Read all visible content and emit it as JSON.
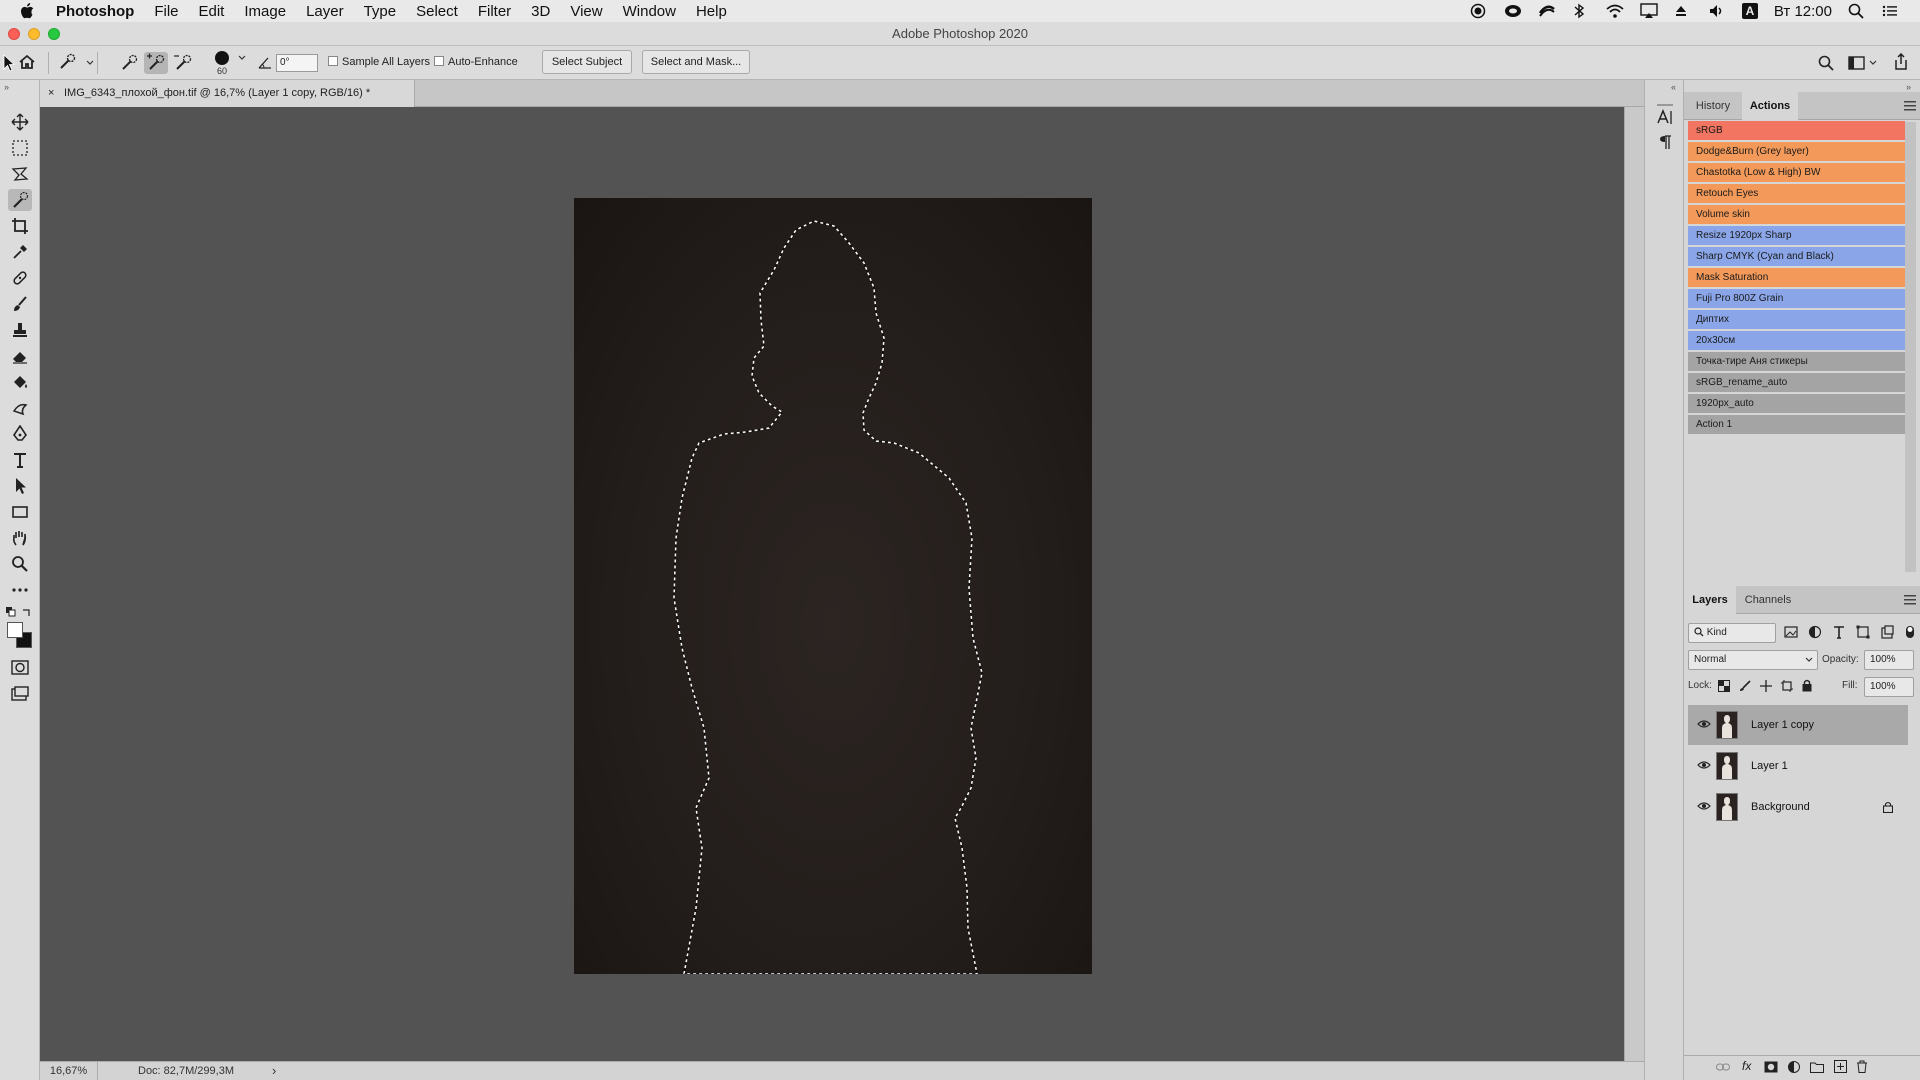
{
  "menubar": {
    "app_name": "Photoshop",
    "items": [
      "File",
      "Edit",
      "Image",
      "Layer",
      "Type",
      "Select",
      "Filter",
      "3D",
      "View",
      "Window",
      "Help"
    ],
    "clock": "Вт 12:00",
    "tray_icons": [
      "record-icon",
      "creative-cloud-icon",
      "sync-icon",
      "bluetooth-icon",
      "wifi-icon",
      "airplay-icon",
      "eject-icon",
      "volume-icon",
      "input-source-icon",
      "spotlight-icon",
      "notification-center-icon"
    ],
    "input_source_label": "A"
  },
  "window": {
    "title": "Adobe Photoshop 2020"
  },
  "options_bar": {
    "brush_size": "60",
    "angle_value": "0°",
    "sample_all_layers": "Sample All Layers",
    "auto_enhance": "Auto-Enhance",
    "select_subject": "Select Subject",
    "select_and_mask": "Select and Mask..."
  },
  "tools": [
    "move-tool",
    "marquee-tool",
    "lasso-tool",
    "quick-selection-tool",
    "crop-tool",
    "eyedropper-tool",
    "healing-tool",
    "brush-tool",
    "stamp-tool",
    "eraser-tool",
    "paint-bucket-tool",
    "smudge-tool",
    "pen-tool",
    "type-tool",
    "path-selection-tool",
    "rectangle-tool",
    "hand-tool",
    "zoom-tool",
    "more-tools",
    "swap-colors",
    "quick-mask",
    "screen-mode"
  ],
  "document": {
    "tab_label": "IMG_6343_плохой_фон.tif @ 16,7% (Layer 1 copy, RGB/16) *",
    "close_glyph": "×"
  },
  "status": {
    "zoom": "16,67%",
    "doc_size": "Doc: 82,7M/299,3M",
    "arrow": "›"
  },
  "history_panel": {
    "tabs": [
      "History",
      "Actions"
    ],
    "actions": [
      {
        "label": "sRGB",
        "color": "#f17560"
      },
      {
        "label": "Dodge&Burn (Grey layer)",
        "color": "#f39a5a"
      },
      {
        "label": "Chastotka (Low & High) BW",
        "color": "#f39a5a"
      },
      {
        "label": "Retouch Eyes",
        "color": "#f39a5a"
      },
      {
        "label": "Volume skin",
        "color": "#f39a5a"
      },
      {
        "label": "Resize 1920px Sharp",
        "color": "#8aa6e8"
      },
      {
        "label": "Sharp CMYK (Cyan and Black)",
        "color": "#8aa6e8"
      },
      {
        "label": "Mask Saturation",
        "color": "#f39a5a"
      },
      {
        "label": "Fuji Pro 800Z Grain",
        "color": "#8aa6e8"
      },
      {
        "label": "Диптих",
        "color": "#8aa6e8"
      },
      {
        "label": "20x30см",
        "color": "#8aa6e8"
      },
      {
        "label": "Точка-тире Аня стикеры",
        "color": "#a4a4a4"
      },
      {
        "label": "sRGB_rename_auto",
        "color": "#a4a4a4"
      },
      {
        "label": "1920px_auto",
        "color": "#a4a4a4"
      },
      {
        "label": "Action 1",
        "color": "#a4a4a4"
      }
    ]
  },
  "layers_panel": {
    "tabs": [
      "Layers",
      "Channels"
    ],
    "filter_kind": "Kind",
    "blend_mode": "Normal",
    "opacity_label": "Opacity:",
    "opacity_value": "100%",
    "lock_label": "Lock:",
    "fill_label": "Fill:",
    "fill_value": "100%",
    "layers": [
      {
        "name": "Layer 1 copy",
        "selected": true,
        "locked": false
      },
      {
        "name": "Layer 1",
        "selected": false,
        "locked": false
      },
      {
        "name": "Background",
        "selected": false,
        "locked": true
      }
    ]
  }
}
